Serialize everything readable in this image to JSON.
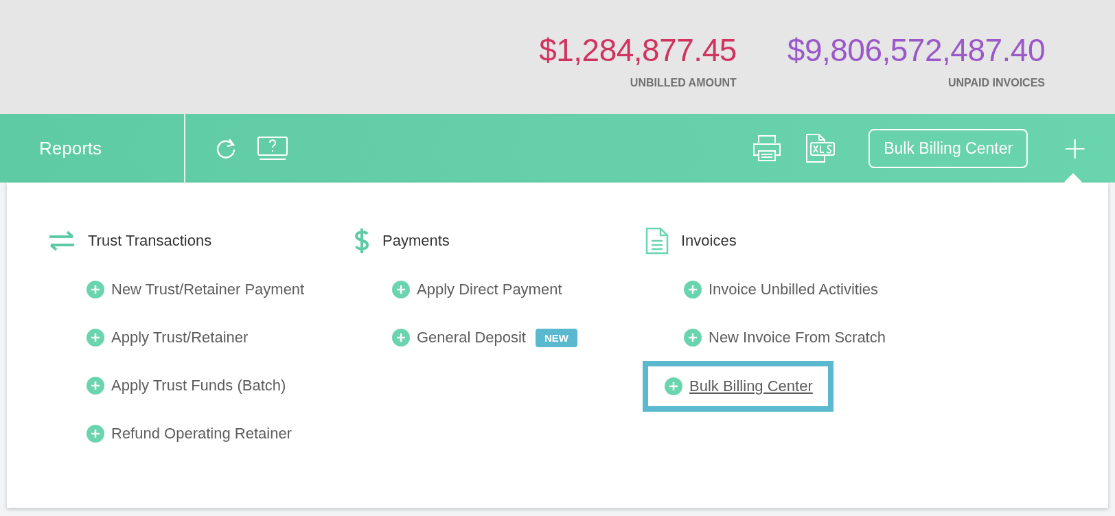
{
  "summary": [
    {
      "amount": "$1,284,877.45",
      "label": "UNBILLED AMOUNT",
      "color": "#d0335f"
    },
    {
      "amount": "$9,806,572,487.40",
      "label": "UNPAID INVOICES",
      "color": "#9a58c9"
    }
  ],
  "toolbar": {
    "title": "Reports",
    "button": "Bulk Billing Center",
    "add": "+"
  },
  "menu": [
    {
      "heading": "Trust Transactions",
      "kind": "transfer",
      "items": [
        {
          "label": "New Trust/Retainer Payment",
          "selected": false
        },
        {
          "label": "Apply Trust/Retainer",
          "selected": false
        },
        {
          "label": "Apply Trust Funds (Batch)",
          "selected": false
        },
        {
          "label": "Refund Operating Retainer",
          "selected": false
        }
      ]
    },
    {
      "heading": "Payments",
      "kind": "dollar",
      "items": [
        {
          "label": "Apply Direct Payment",
          "selected": false
        },
        {
          "label": "General Deposit",
          "badge": "NEW",
          "selected": false
        }
      ]
    },
    {
      "heading": "Invoices",
      "kind": "document",
      "items": [
        {
          "label": "Invoice Unbilled Activities",
          "selected": false
        },
        {
          "label": "New Invoice From Scratch",
          "selected": false
        },
        {
          "label": "Bulk Billing Center",
          "selected": true
        }
      ]
    }
  ]
}
